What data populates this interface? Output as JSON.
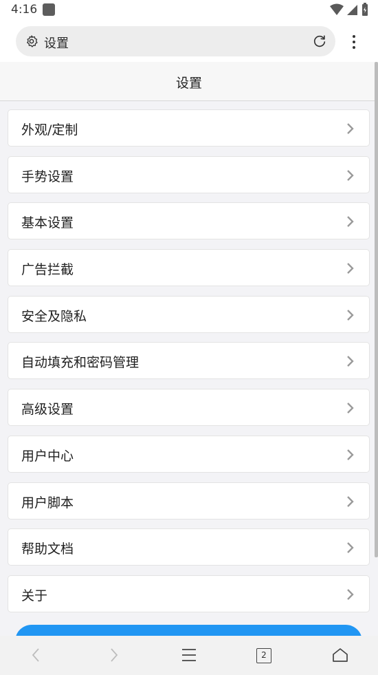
{
  "status_bar": {
    "time": "4:16"
  },
  "browser": {
    "url_text": "设置"
  },
  "page": {
    "title": "设置"
  },
  "settings": [
    {
      "label": "外观/定制"
    },
    {
      "label": "手势设置"
    },
    {
      "label": "基本设置"
    },
    {
      "label": "广告拦截"
    },
    {
      "label": "安全及隐私"
    },
    {
      "label": "自动填充和密码管理"
    },
    {
      "label": "高级设置"
    },
    {
      "label": "用户中心"
    },
    {
      "label": "用户脚本"
    },
    {
      "label": "帮助文档"
    },
    {
      "label": "关于"
    }
  ],
  "bottom_nav": {
    "tab_count": "2"
  },
  "colors": {
    "accent": "#2196f3",
    "background": "#f3f3f6"
  }
}
